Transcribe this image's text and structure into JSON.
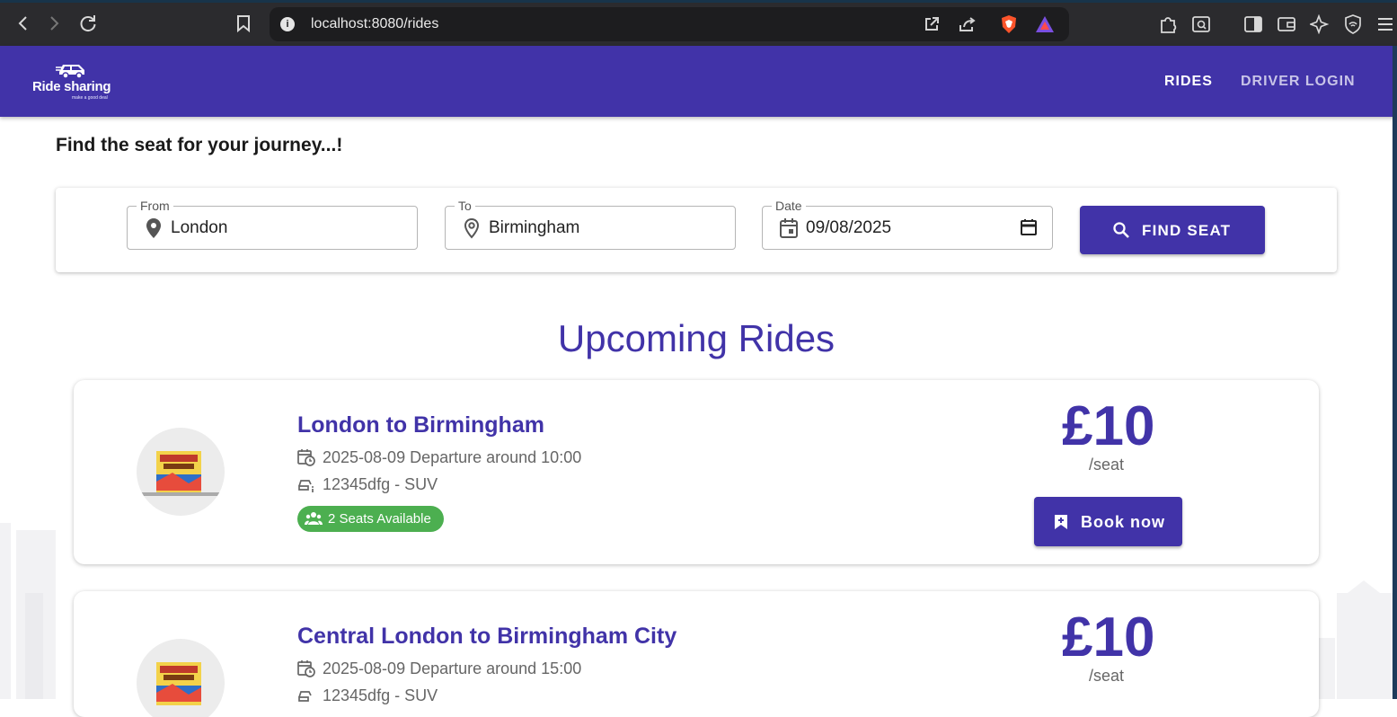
{
  "browser": {
    "url": "localhost:8080/rides"
  },
  "appbar": {
    "brand": "Ride sharing",
    "tagline": "make a good deal",
    "nav": [
      {
        "label": "RIDES"
      },
      {
        "label": "DRIVER LOGIN"
      }
    ]
  },
  "search": {
    "headline": "Find the seat for your journey...!",
    "from": {
      "label": "From",
      "value": "London"
    },
    "to": {
      "label": "To",
      "value": "Birmingham"
    },
    "date": {
      "label": "Date",
      "value": "09/08/2025"
    },
    "button_label": "FIND SEAT"
  },
  "section_title": "Upcoming Rides",
  "rides": [
    {
      "title": "London to Birmingham",
      "departure": "2025-08-09 Departure around 10:00",
      "vehicle": "12345dfg - SUV",
      "seats": "2 Seats Available",
      "price": "£10",
      "per_seat": "/seat",
      "book_label": "Book now"
    },
    {
      "title": "Central London to Birmingham City",
      "departure": "2025-08-09 Departure around 15:00",
      "vehicle": "12345dfg - SUV",
      "price": "£10",
      "per_seat": "/seat"
    }
  ],
  "colors": {
    "primary": "#4133a8",
    "seats_badge": "#4caf50"
  }
}
